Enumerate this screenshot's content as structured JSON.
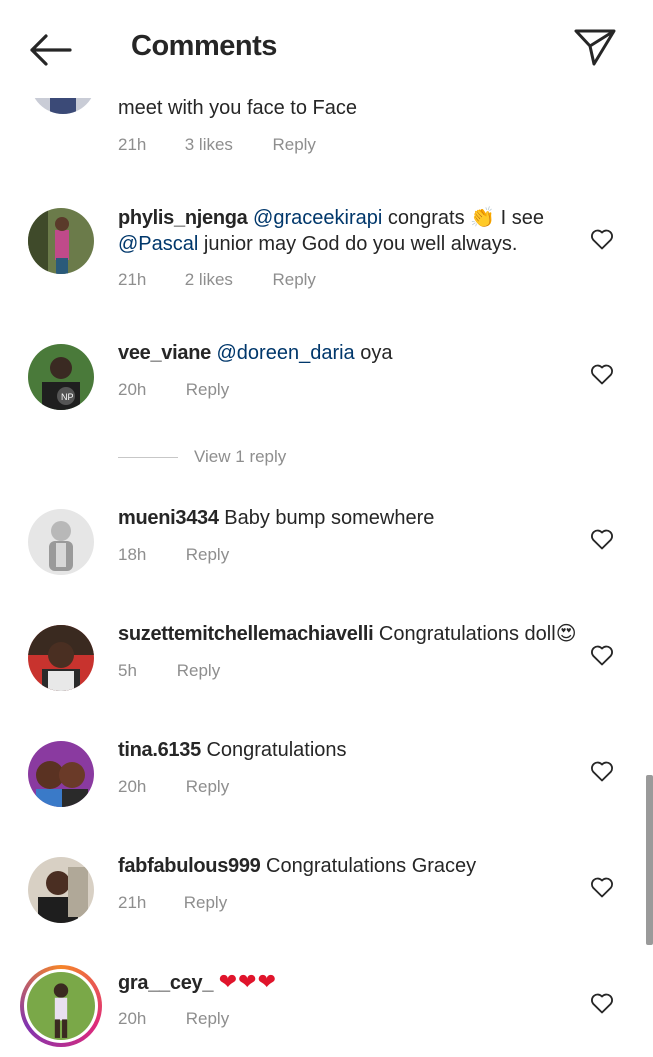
{
  "header": {
    "title": "Comments"
  },
  "comments": [
    {
      "username": "",
      "pre": "",
      "mention": "",
      "text": "meet with you face to Face",
      "time": "21h",
      "likes": "3 likes",
      "reply": "Reply"
    },
    {
      "username": "phylis_njenga",
      "mention": "@graceekirapi",
      "text": " congrats ",
      "emoji": "👏",
      "text2": " I see ",
      "mention2": "@Pascal",
      "text3": " junior may God do you well always.",
      "time": "21h",
      "likes": "2 likes",
      "reply": "Reply"
    },
    {
      "username": "vee_viane",
      "mention": "@doreen_daria",
      "text": " oya",
      "time": "20h",
      "reply": "Reply",
      "view_replies": "View 1 reply"
    },
    {
      "username": "mueni3434",
      "text": " Baby bump somewhere",
      "time": "18h",
      "reply": "Reply"
    },
    {
      "username": "suzettemitchellemachiavelli",
      "text": " Congratulations doll",
      "emoji": "😍",
      "time": "5h",
      "reply": "Reply"
    },
    {
      "username": "tina.6135",
      "text": " Congratulations",
      "time": "20h",
      "reply": "Reply"
    },
    {
      "username": "fabfabulous999",
      "text": " Congratulations Gracey",
      "time": "21h",
      "reply": "Reply"
    },
    {
      "username": "gra__cey_",
      "hearts": "❤❤❤",
      "time": "20h",
      "reply": "Reply"
    }
  ],
  "colors": {
    "mention": "#00376b",
    "meta": "#8e8e8e",
    "text": "#262626",
    "heart": "#e0142b"
  },
  "icons": {
    "back": "back-arrow-icon",
    "send": "paper-plane-icon",
    "like": "heart-outline-icon"
  }
}
